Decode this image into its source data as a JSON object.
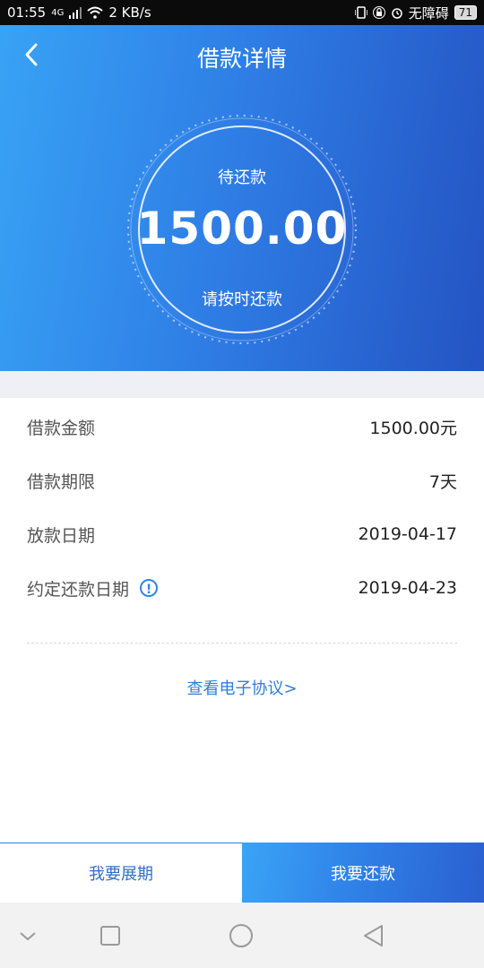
{
  "status_bar": {
    "time": "01:55",
    "network": "4G",
    "speed": "2 KB/s",
    "accessibility": "无障碍",
    "battery": "71"
  },
  "header": {
    "title": "借款详情",
    "pending_label": "待还款",
    "amount": "1500.00",
    "reminder": "请按时还款"
  },
  "details": [
    {
      "label": "借款金额",
      "value": "1500.00元"
    },
    {
      "label": "借款期限",
      "value": "7天"
    },
    {
      "label": "放款日期",
      "value": "2019-04-17"
    },
    {
      "label": "约定还款日期",
      "value": "2019-04-23",
      "has_info_icon": true
    }
  ],
  "agreement_link": "查看电子协议>",
  "actions": {
    "extend": "我要展期",
    "repay": "我要还款"
  },
  "colors": {
    "gradient_start": "#38a3f5",
    "gradient_end": "#2453c4",
    "link": "#2f7fd6",
    "separator": "#eef0f5"
  },
  "icons": {
    "back": "chevron-left-icon",
    "info": "info-icon",
    "nav_down": "chevron-down-icon",
    "nav_recent": "square-icon",
    "nav_home": "circle-icon",
    "nav_back": "triangle-left-icon"
  }
}
